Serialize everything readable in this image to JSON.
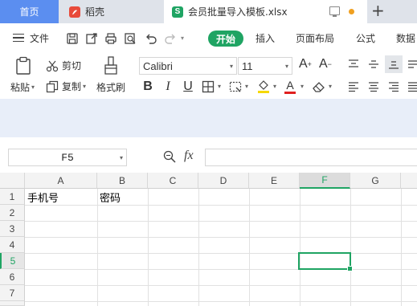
{
  "tabs": {
    "home": "首页",
    "daoke": "稻壳",
    "file": "会员批量导入模板.xlsx"
  },
  "menu": {
    "file": "文件",
    "start": "开始",
    "insert": "插入",
    "layout": "页面布局",
    "formula": "公式",
    "data": "数据"
  },
  "toolbar": {
    "paste": "粘贴",
    "cut": "剪切",
    "copy": "复制",
    "format_painter": "格式刷",
    "font_name": "Calibri",
    "font_size": "11"
  },
  "formula_bar": {
    "name_box": "F5",
    "fx": "fx"
  },
  "sheet": {
    "columns": [
      "A",
      "B",
      "C",
      "D",
      "E",
      "F",
      "G"
    ],
    "rows": [
      "1",
      "2",
      "3",
      "4",
      "5",
      "6",
      "7"
    ],
    "active_column": "F",
    "active_row": "5",
    "cells": {
      "A1": "手机号",
      "B1": "密码"
    }
  },
  "colors": {
    "accent_green": "#1fa463",
    "home_tab_blue": "#5b8ef0"
  }
}
